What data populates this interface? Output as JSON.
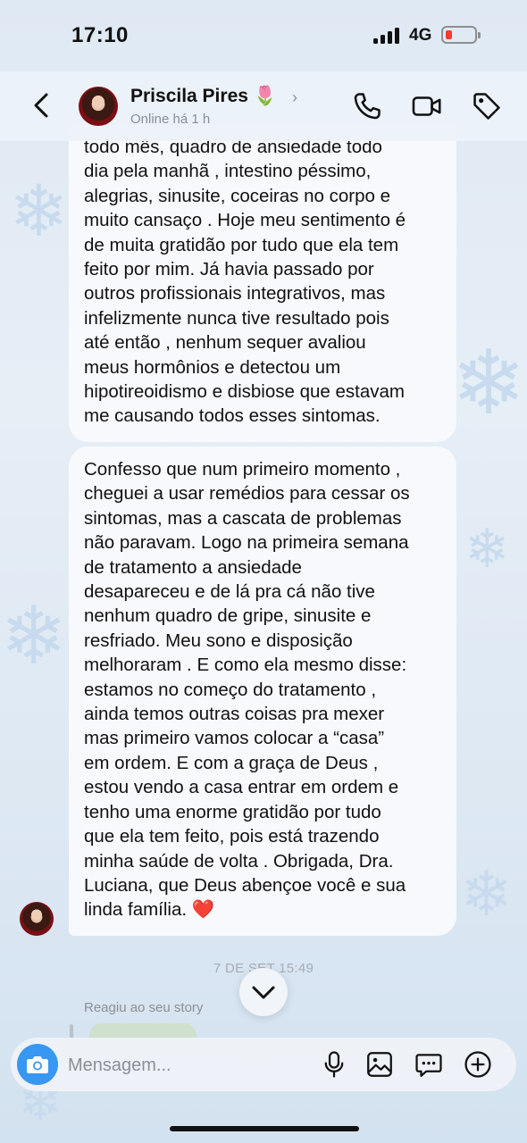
{
  "status_bar": {
    "time": "17:10",
    "network": "4G"
  },
  "header": {
    "contact_name": "Priscila Pires 🌷",
    "status": "Online há 1 h",
    "icons": [
      "back-icon",
      "phone-icon",
      "video-camera-icon",
      "tag-icon"
    ]
  },
  "messages": [
    {
      "sender": "contact",
      "text": "todo mês, quadro de ansiedade todo\ndia pela manhã , intestino péssimo,\nalegrias, sinusite, coceiras no corpo e\nmuito cansaço . Hoje meu sentimento é\nde muita gratidão por tudo que ela tem\nfeito por mim. Já havia passado por\noutros profissionais integrativos, mas\ninfelizmente nunca tive resultado pois\naté então , nenhum sequer avaliou\nmeus hormônios e detectou um\nhipotireoidismo e disbiose que estavam\nme causando todos esses sintomas."
    },
    {
      "sender": "contact",
      "text": "Confesso que num primeiro momento ,\ncheguei a usar remédios para cessar os\nsintomas, mas a cascata de problemas\nnão paravam. Logo na primeira semana\nde tratamento a ansiedade\ndesapareceu e de lá pra cá não tive\nnenhum quadro de gripe, sinusite e\nresfriado.  Meu sono e disposição\nmelhoraram . E como ela mesmo disse:\nestamos no começo do tratamento ,\nainda temos outras coisas pra mexer\nmas primeiro vamos colocar a “casa”\nem ordem. E com a graça de Deus ,\nestou vendo a casa entrar em ordem e\ntenho uma enorme gratidão por tudo\nque ela tem feito, pois está trazendo\nminha saúde de volta . Obrigada, Dra.\nLuciana, que Deus abençoe você e sua\nlinda família. ❤️"
    }
  ],
  "timestamp": "7 DE SET   15:49",
  "reaction_note": "Reagiu ao seu story",
  "composer": {
    "placeholder": "Mensagem...",
    "icons": [
      "camera-icon",
      "microphone-icon",
      "gallery-icon",
      "sticker-chat-icon",
      "plus-icon"
    ]
  },
  "colors": {
    "camera_button": "#3897f0",
    "battery_low": "#ff3b30",
    "bubble": "#f7f9fc"
  }
}
